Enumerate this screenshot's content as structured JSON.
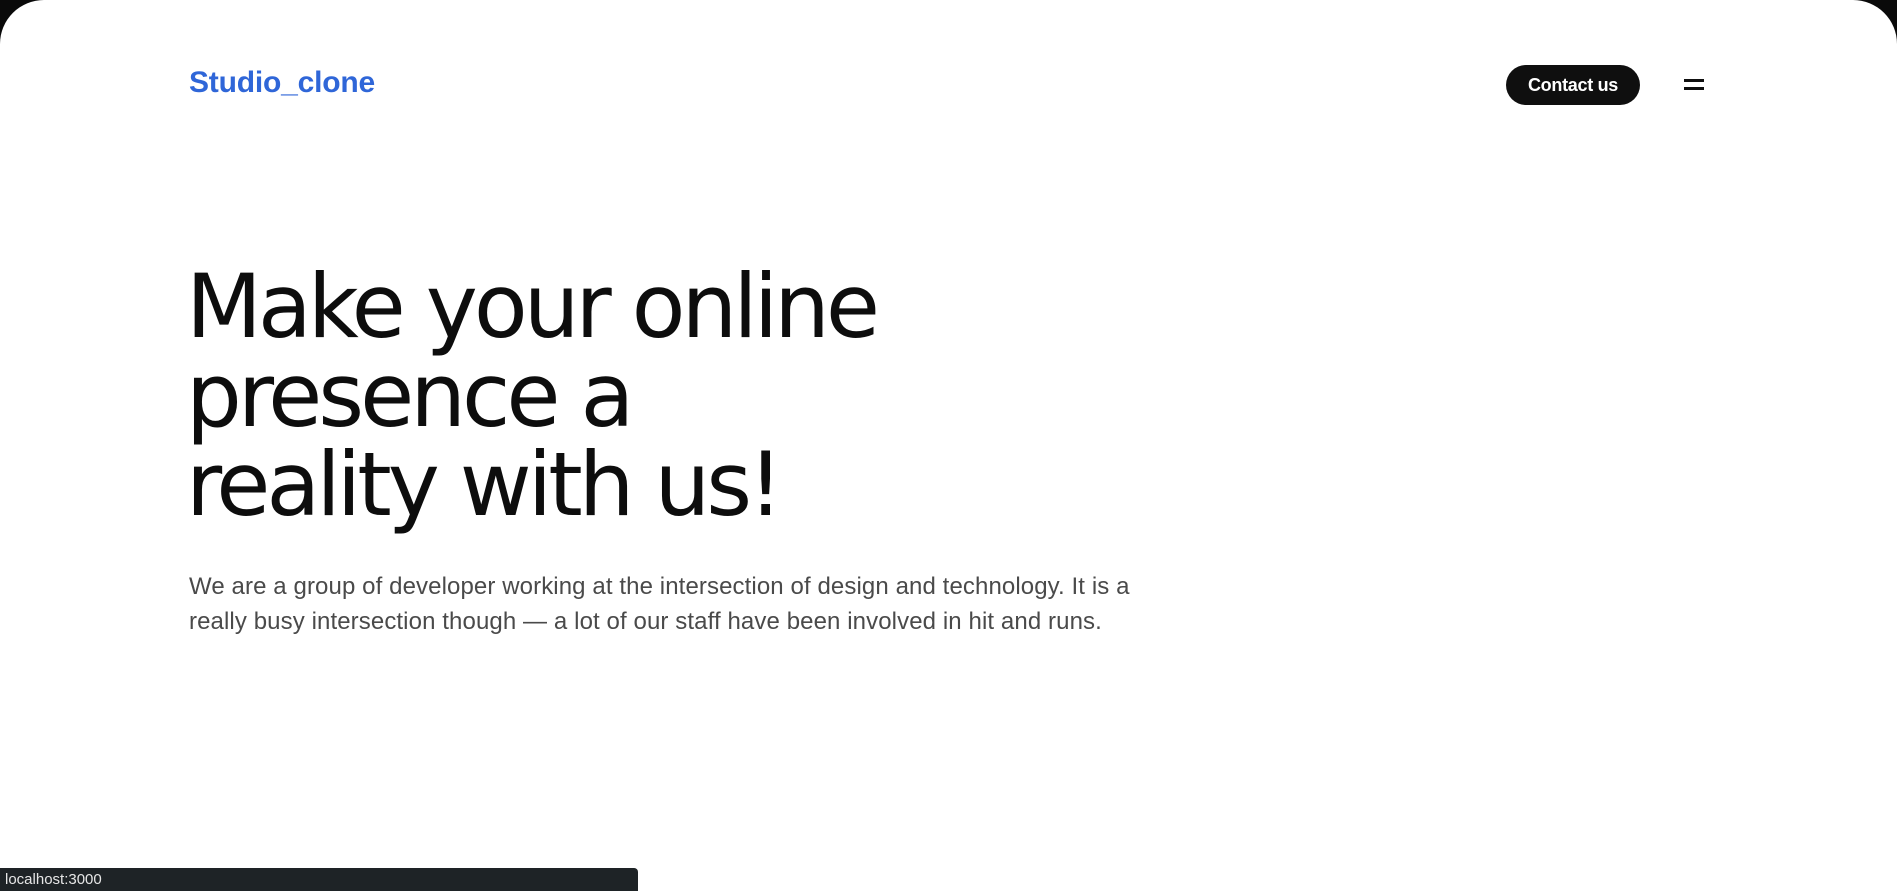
{
  "header": {
    "logo": "Studio_clone",
    "contact_label": "Contact us",
    "menu_icon": "hamburger-menu-icon"
  },
  "hero": {
    "title_lines": [
      "Make your online",
      "presence a",
      "reality with us!"
    ],
    "description": "We are a group of developer working at the intersection of design and technology. It is a really busy intersection though — a lot of our staff have been involved in hit and runs."
  },
  "status_bar": {
    "url": "localhost:3000"
  },
  "colors": {
    "brand": "#2f66d8",
    "button_bg": "#0f0f0f",
    "text_dark": "#0d0d0d",
    "text_body": "#4a4a4a",
    "window_bg": "#0a0a0a"
  }
}
